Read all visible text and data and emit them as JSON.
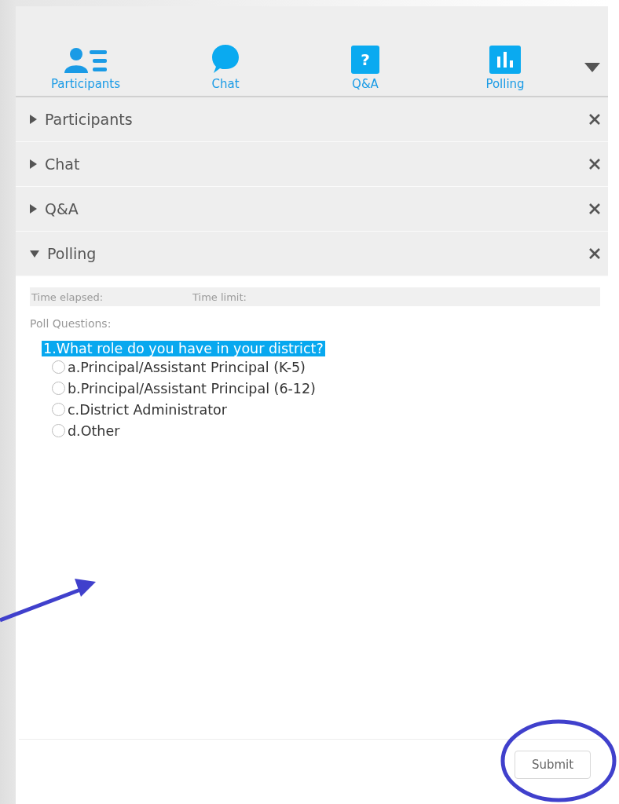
{
  "toolbar": {
    "tabs": [
      {
        "label": "Participants",
        "kind": "people"
      },
      {
        "label": "Chat",
        "kind": "bubble"
      },
      {
        "label": "Q&A",
        "kind": "question",
        "glyph": "?"
      },
      {
        "label": "Polling",
        "kind": "bars"
      }
    ]
  },
  "sections": [
    {
      "title": "Participants",
      "expanded": false
    },
    {
      "title": "Chat",
      "expanded": false
    },
    {
      "title": "Q&A",
      "expanded": false
    },
    {
      "title": "Polling",
      "expanded": true
    }
  ],
  "polling": {
    "time_elapsed_label": "Time elapsed:",
    "time_limit_label": "Time limit:",
    "heading": "Poll Questions:",
    "question": "1.What role do you have in your district?",
    "options": [
      {
        "label": "a.Principal/Assistant Principal (K-5)",
        "selected": false
      },
      {
        "label": "b.Principal/Assistant Principal (6-12)",
        "selected": false
      },
      {
        "label": "c.District Administrator",
        "selected": false
      },
      {
        "label": "d.Other",
        "selected": false
      }
    ],
    "submit": "Submit"
  }
}
